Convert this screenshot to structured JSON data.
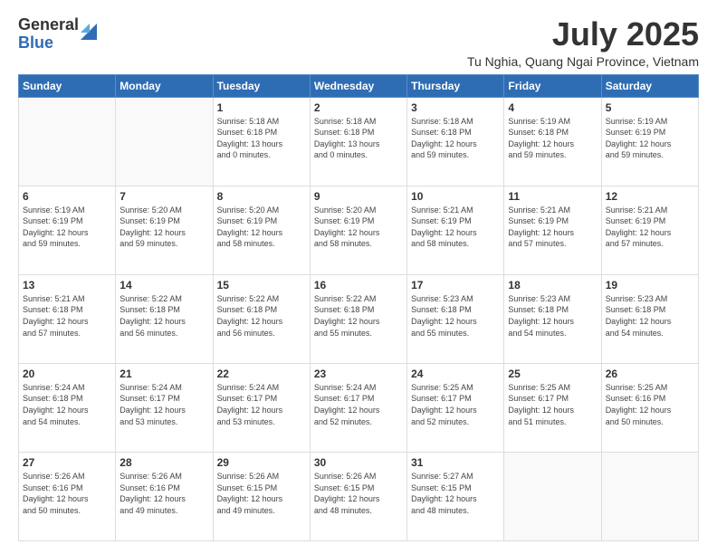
{
  "logo": {
    "general": "General",
    "blue": "Blue"
  },
  "header": {
    "month_year": "July 2025",
    "location": "Tu Nghia, Quang Ngai Province, Vietnam"
  },
  "weekdays": [
    "Sunday",
    "Monday",
    "Tuesday",
    "Wednesday",
    "Thursday",
    "Friday",
    "Saturday"
  ],
  "weeks": [
    [
      {
        "day": "",
        "info": ""
      },
      {
        "day": "",
        "info": ""
      },
      {
        "day": "1",
        "info": "Sunrise: 5:18 AM\nSunset: 6:18 PM\nDaylight: 13 hours\nand 0 minutes."
      },
      {
        "day": "2",
        "info": "Sunrise: 5:18 AM\nSunset: 6:18 PM\nDaylight: 13 hours\nand 0 minutes."
      },
      {
        "day": "3",
        "info": "Sunrise: 5:18 AM\nSunset: 6:18 PM\nDaylight: 12 hours\nand 59 minutes."
      },
      {
        "day": "4",
        "info": "Sunrise: 5:19 AM\nSunset: 6:18 PM\nDaylight: 12 hours\nand 59 minutes."
      },
      {
        "day": "5",
        "info": "Sunrise: 5:19 AM\nSunset: 6:19 PM\nDaylight: 12 hours\nand 59 minutes."
      }
    ],
    [
      {
        "day": "6",
        "info": "Sunrise: 5:19 AM\nSunset: 6:19 PM\nDaylight: 12 hours\nand 59 minutes."
      },
      {
        "day": "7",
        "info": "Sunrise: 5:20 AM\nSunset: 6:19 PM\nDaylight: 12 hours\nand 59 minutes."
      },
      {
        "day": "8",
        "info": "Sunrise: 5:20 AM\nSunset: 6:19 PM\nDaylight: 12 hours\nand 58 minutes."
      },
      {
        "day": "9",
        "info": "Sunrise: 5:20 AM\nSunset: 6:19 PM\nDaylight: 12 hours\nand 58 minutes."
      },
      {
        "day": "10",
        "info": "Sunrise: 5:21 AM\nSunset: 6:19 PM\nDaylight: 12 hours\nand 58 minutes."
      },
      {
        "day": "11",
        "info": "Sunrise: 5:21 AM\nSunset: 6:19 PM\nDaylight: 12 hours\nand 57 minutes."
      },
      {
        "day": "12",
        "info": "Sunrise: 5:21 AM\nSunset: 6:19 PM\nDaylight: 12 hours\nand 57 minutes."
      }
    ],
    [
      {
        "day": "13",
        "info": "Sunrise: 5:21 AM\nSunset: 6:18 PM\nDaylight: 12 hours\nand 57 minutes."
      },
      {
        "day": "14",
        "info": "Sunrise: 5:22 AM\nSunset: 6:18 PM\nDaylight: 12 hours\nand 56 minutes."
      },
      {
        "day": "15",
        "info": "Sunrise: 5:22 AM\nSunset: 6:18 PM\nDaylight: 12 hours\nand 56 minutes."
      },
      {
        "day": "16",
        "info": "Sunrise: 5:22 AM\nSunset: 6:18 PM\nDaylight: 12 hours\nand 55 minutes."
      },
      {
        "day": "17",
        "info": "Sunrise: 5:23 AM\nSunset: 6:18 PM\nDaylight: 12 hours\nand 55 minutes."
      },
      {
        "day": "18",
        "info": "Sunrise: 5:23 AM\nSunset: 6:18 PM\nDaylight: 12 hours\nand 54 minutes."
      },
      {
        "day": "19",
        "info": "Sunrise: 5:23 AM\nSunset: 6:18 PM\nDaylight: 12 hours\nand 54 minutes."
      }
    ],
    [
      {
        "day": "20",
        "info": "Sunrise: 5:24 AM\nSunset: 6:18 PM\nDaylight: 12 hours\nand 54 minutes."
      },
      {
        "day": "21",
        "info": "Sunrise: 5:24 AM\nSunset: 6:17 PM\nDaylight: 12 hours\nand 53 minutes."
      },
      {
        "day": "22",
        "info": "Sunrise: 5:24 AM\nSunset: 6:17 PM\nDaylight: 12 hours\nand 53 minutes."
      },
      {
        "day": "23",
        "info": "Sunrise: 5:24 AM\nSunset: 6:17 PM\nDaylight: 12 hours\nand 52 minutes."
      },
      {
        "day": "24",
        "info": "Sunrise: 5:25 AM\nSunset: 6:17 PM\nDaylight: 12 hours\nand 52 minutes."
      },
      {
        "day": "25",
        "info": "Sunrise: 5:25 AM\nSunset: 6:17 PM\nDaylight: 12 hours\nand 51 minutes."
      },
      {
        "day": "26",
        "info": "Sunrise: 5:25 AM\nSunset: 6:16 PM\nDaylight: 12 hours\nand 50 minutes."
      }
    ],
    [
      {
        "day": "27",
        "info": "Sunrise: 5:26 AM\nSunset: 6:16 PM\nDaylight: 12 hours\nand 50 minutes."
      },
      {
        "day": "28",
        "info": "Sunrise: 5:26 AM\nSunset: 6:16 PM\nDaylight: 12 hours\nand 49 minutes."
      },
      {
        "day": "29",
        "info": "Sunrise: 5:26 AM\nSunset: 6:15 PM\nDaylight: 12 hours\nand 49 minutes."
      },
      {
        "day": "30",
        "info": "Sunrise: 5:26 AM\nSunset: 6:15 PM\nDaylight: 12 hours\nand 48 minutes."
      },
      {
        "day": "31",
        "info": "Sunrise: 5:27 AM\nSunset: 6:15 PM\nDaylight: 12 hours\nand 48 minutes."
      },
      {
        "day": "",
        "info": ""
      },
      {
        "day": "",
        "info": ""
      }
    ]
  ]
}
